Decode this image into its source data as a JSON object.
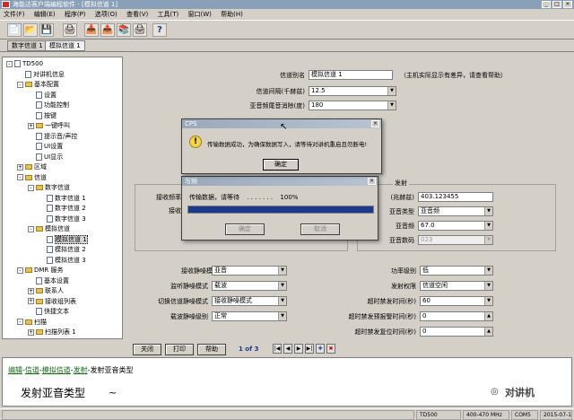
{
  "window": {
    "title": "海能达客户端编程软件 - [模拟信道 1]",
    "minimize": "_",
    "restore": "□",
    "close": "×"
  },
  "menu": [
    "文件(F)",
    "编辑(E)",
    "程序(P)",
    "选项(O)",
    "查看(V)",
    "工具(T)",
    "窗口(W)",
    "帮助(H)"
  ],
  "tabs": [
    "数字信道 1",
    "模拟信道 1"
  ],
  "tree": [
    {
      "label": "TD500",
      "d": 0,
      "exp": "-",
      "k": "c"
    },
    {
      "label": "对讲机信息",
      "d": 1,
      "k": "f"
    },
    {
      "label": "基本配置",
      "d": 1,
      "exp": "-",
      "k": "fo"
    },
    {
      "label": "设置",
      "d": 2,
      "k": "f"
    },
    {
      "label": "功能控制",
      "d": 2,
      "k": "f"
    },
    {
      "label": "按键",
      "d": 2,
      "k": "f"
    },
    {
      "label": "一键呼叫",
      "d": 2,
      "exp": "+",
      "k": "fo"
    },
    {
      "label": "提示音/声控",
      "d": 2,
      "k": "f"
    },
    {
      "label": "UI设置",
      "d": 2,
      "k": "f"
    },
    {
      "label": "UI显示",
      "d": 2,
      "k": "f"
    },
    {
      "label": "区域",
      "d": 1,
      "exp": "+",
      "k": "fo"
    },
    {
      "label": "信道",
      "d": 1,
      "exp": "-",
      "k": "fo"
    },
    {
      "label": "数字信道",
      "d": 2,
      "exp": "-",
      "k": "fo"
    },
    {
      "label": "数字信道 1",
      "d": 3,
      "k": "f"
    },
    {
      "label": "数字信道 2",
      "d": 3,
      "k": "f"
    },
    {
      "label": "数字信道 3",
      "d": 3,
      "k": "f"
    },
    {
      "label": "模拟信道",
      "d": 2,
      "exp": "-",
      "k": "fo"
    },
    {
      "label": "模拟信道 1",
      "d": 3,
      "k": "f",
      "sel": true
    },
    {
      "label": "模拟信道 2",
      "d": 3,
      "k": "f"
    },
    {
      "label": "模拟信道 3",
      "d": 3,
      "k": "f"
    },
    {
      "label": "DMR 服务",
      "d": 1,
      "exp": "-",
      "k": "fo"
    },
    {
      "label": "基本设置",
      "d": 2,
      "k": "f"
    },
    {
      "label": "联系人",
      "d": 2,
      "exp": "+",
      "k": "fo"
    },
    {
      "label": "接收组列表",
      "d": 2,
      "exp": "+",
      "k": "fo"
    },
    {
      "label": "快捷文本",
      "d": 2,
      "k": "f"
    },
    {
      "label": "扫描",
      "d": 1,
      "exp": "-",
      "k": "fo"
    },
    {
      "label": "扫描列表 1",
      "d": 2,
      "exp": "+",
      "k": "fo"
    }
  ],
  "form": {
    "alias_label": "信道别名",
    "alias_value": "模拟信道 1",
    "alias_note": "（主机实际显示有差异，请查看帮助）",
    "spacing_label": "信道间隔(千赫兹)",
    "spacing_value": "12.5",
    "squelch_label": "亚音频尾音消除(度)",
    "squelch_value": "180",
    "tx_group": "发射",
    "freq_label": "(兆赫兹)",
    "freq_value": "403.123455",
    "tone_type_label": "亚音类型",
    "tone_type_value": "亚音频",
    "tone_freq_label": "亚音频",
    "tone_freq_value": "67.0",
    "tone_code_label": "亚音数码",
    "tone_code_value": "023",
    "rx_freq_label": "接收频率",
    "rx_label2": "接收",
    "rx_mute_label": "接收静噪模式",
    "rx_mute_value": "亚音",
    "mon_mute_label": "监听静噪模式",
    "mon_mute_value": "载波",
    "sw_mute_label": "切换信道静噪模式",
    "sw_mute_value": "接收静噪模式",
    "level_label": "载波静噪级别",
    "level_value": "正常",
    "power_label": "功率级别",
    "power_value": "低",
    "permit_label": "发射权限",
    "permit_value": "信道空闲",
    "tot_label": "超时禁发时间(秒)",
    "tot_value": "60",
    "tot_pre_label": "超时禁发预报警时间(秒)",
    "tot_pre_value": "0",
    "tot_reset_label": "超时禁发复位时间(秒)",
    "tot_reset_value": "0"
  },
  "bottom": {
    "close": "关闭",
    "print": "打印",
    "help": "帮助",
    "page": "1 of 3",
    "n_first": "|◀",
    "n_prev": "◀",
    "n_next": "▶",
    "n_last": "▶|"
  },
  "help": {
    "crumb1": "编辑",
    "crumb2": "信道",
    "crumb3": "模拟信道",
    "crumb4": "发射",
    "crumb_tail": "-发射亚音类型",
    "sep": "-",
    "heading": "发射亚音类型",
    "watermark": "对讲机"
  },
  "status": [
    "TD500",
    "400-470 MHz",
    "COM5",
    "2015-07-10 09:35:1"
  ],
  "cps_dialog": {
    "title": "CPS",
    "message": "传输数据成功，为确保数据写入，请等待对讲机重启且勿断电!",
    "ok": "确定",
    "close": "×"
  },
  "progress_dialog": {
    "title": "写频",
    "message": "传输数据，请等待",
    "dots": ". . . . . . .",
    "percent": "100%",
    "progress": 1.0,
    "ok": "确定",
    "cancel": "取消",
    "close": "×"
  },
  "colors": {
    "help_link": "#1a6e1a",
    "progress": "#1b3a8c"
  },
  "icons": {
    "new": "📄",
    "open": "📂",
    "save": "💾",
    "print": "🖨",
    "read": "📥",
    "write": "📤",
    "ref": "📚",
    "help": "?"
  }
}
